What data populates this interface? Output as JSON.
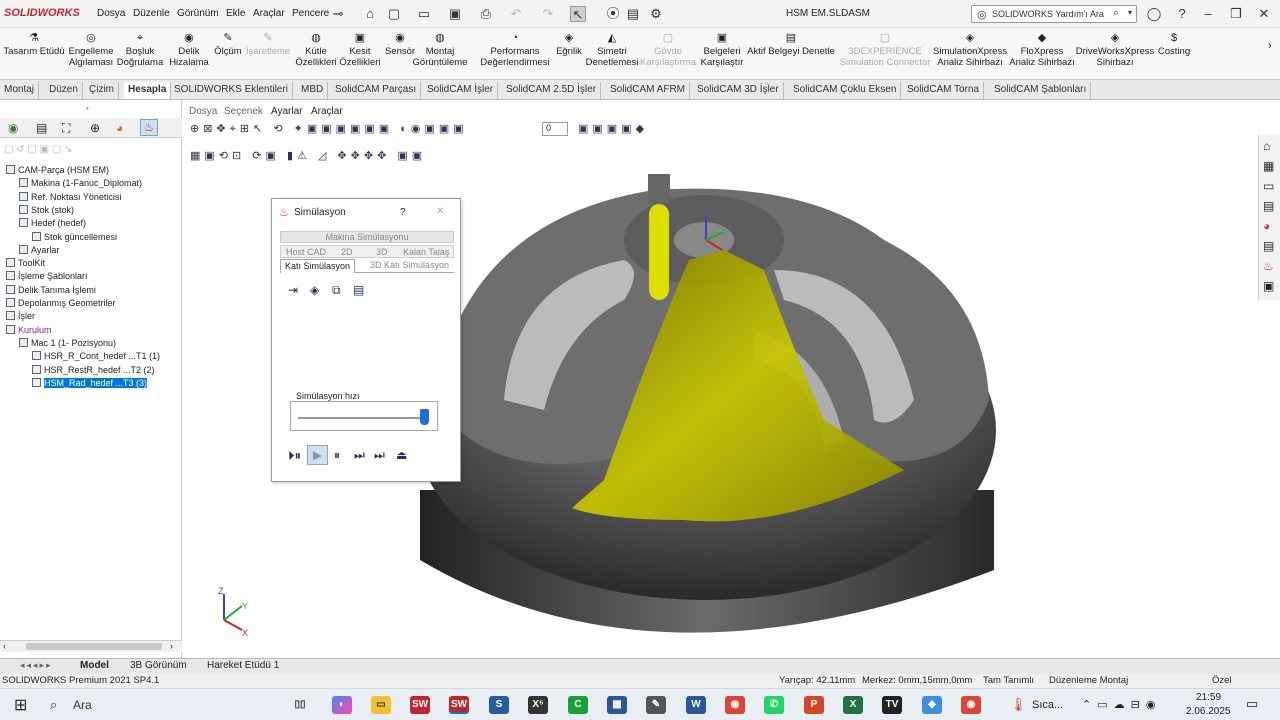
{
  "titlebar": {
    "brand": "SOLIDWORKS",
    "menus": [
      "Dosya",
      "Düzenle",
      "Görünüm",
      "Ekle",
      "Araçlar",
      "Pencere"
    ],
    "document": "HSM EM.SLDASM",
    "search_placeholder": "SOLIDWORKS Yardım'ı Ara"
  },
  "commands": [
    {
      "label": "Tasarım Etüdü"
    },
    {
      "label": "Engelleme\nAlgılaması"
    },
    {
      "label": "Boşluk\nDoğrulama"
    },
    {
      "label": "Delik\nHizalama"
    },
    {
      "label": "Ölçüm"
    },
    {
      "label": "İşaretleme",
      "disabled": true
    },
    {
      "label": "Kütle\nÖzellikleri"
    },
    {
      "label": "Kesit\nÖzellikleri"
    },
    {
      "label": "Sensör"
    },
    {
      "label": "Montaj\nGörüntüleme"
    },
    {
      "label": "Performans\nDeğerlendirmesi"
    },
    {
      "label": "Eğrilik"
    },
    {
      "label": "Simetri\nDenetlemesi"
    },
    {
      "label": "Gövde\nKarşılaştırma",
      "disabled": true
    },
    {
      "label": "Belgeleri\nKarşılaştır"
    },
    {
      "label": "Aktif Belgeyi Denetle"
    },
    {
      "label": "3DEXPERIENCE\nSimulation Connector",
      "disabled": true
    },
    {
      "label": "SimulationXpress\nAnaliz Sihirbazı"
    },
    {
      "label": "FloXpress\nAnaliz Sihirbazı"
    },
    {
      "label": "DriveWorksXpress\nSihirbazı"
    },
    {
      "label": "Costing"
    }
  ],
  "tabs": [
    "Montaj",
    "Düzen",
    "Çizim",
    "Hesapla",
    "SOLIDWORKS Eklentileri",
    "MBD",
    "SolidCAM Parçası",
    "SolidCAM İşler",
    "SolidCAM 2.5D İşler",
    "SolidCAM AFRM",
    "SolidCAM 3D İşler",
    "SolidCAM Çoklu Eksen",
    "SolidCAM Torna",
    "SolidCAM Şablonları"
  ],
  "active_tab": "Hesapla",
  "tree": [
    {
      "label": "CAM-Parça (HSM EM)",
      "indent": 0
    },
    {
      "label": "Makina (1-Fanuc_Diplomat)",
      "indent": 1
    },
    {
      "label": "Ref. Noktası Yöneticisi",
      "indent": 1
    },
    {
      "label": "Stok (stok)",
      "indent": 1
    },
    {
      "label": "Hedef (hedef)",
      "indent": 1
    },
    {
      "label": "Stok güncellemesi",
      "indent": 2
    },
    {
      "label": "Ayarlar",
      "indent": 1
    },
    {
      "label": "ToolKit",
      "indent": 0
    },
    {
      "label": "İşleme Şablonları",
      "indent": 0
    },
    {
      "label": "Delik Tanıma İşlemi",
      "indent": 0
    },
    {
      "label": "Depolanmış Geometriler",
      "indent": 0
    },
    {
      "label": "İşler",
      "indent": 0
    },
    {
      "label": "Kurulum",
      "indent": 0,
      "color": "#8a1d9a"
    },
    {
      "label": "Mac 1 (1- Pozisyonu)",
      "indent": 1
    },
    {
      "label": "HSR_R_Cont_hedef ...T1 (1)",
      "indent": 2
    },
    {
      "label": "HSR_RestR_hedef ...T2 (2)",
      "indent": 2
    },
    {
      "label": "HSM_Rad_hedef ...T3 (3)",
      "indent": 2,
      "selected": true
    }
  ],
  "viewport_menu": [
    "Dosya",
    "Seçenek",
    "Ayarlar",
    "Araçlar"
  ],
  "viewport_spin_value": "0",
  "dialog": {
    "title": "Simülasyon",
    "help": "?",
    "tab_row1": "Makina Simülasyonu",
    "tab_row2": [
      "Host CAD",
      "2D",
      "3D",
      "Kalan Talaş"
    ],
    "tab_row3": [
      "Katı Simülasyon",
      "3D Katı Simülasyon"
    ],
    "speed_label": "Simülasyon hızı",
    "speed_fraction": 1.0
  },
  "bottom_tabs": [
    "Model",
    "3B Görünüm",
    "Hareket Etüdü 1"
  ],
  "status": {
    "left": "SOLIDWORKS Premium 2021 SP4.1",
    "radius": "Yarıçap: 42.11mm",
    "center": "Merkez: 0mm,15mm,0mm",
    "units": "Tam Tanımlı",
    "mode": "Düzenleme Montaj",
    "custom": "Özel"
  },
  "taskbar": {
    "search": "Ara",
    "weather": "Sıca...",
    "time": "21:59",
    "date": "2.06.2025"
  },
  "colors": {
    "accent": "#0078d7",
    "toolpath": "#c8c800",
    "brand": "#c0272d"
  }
}
